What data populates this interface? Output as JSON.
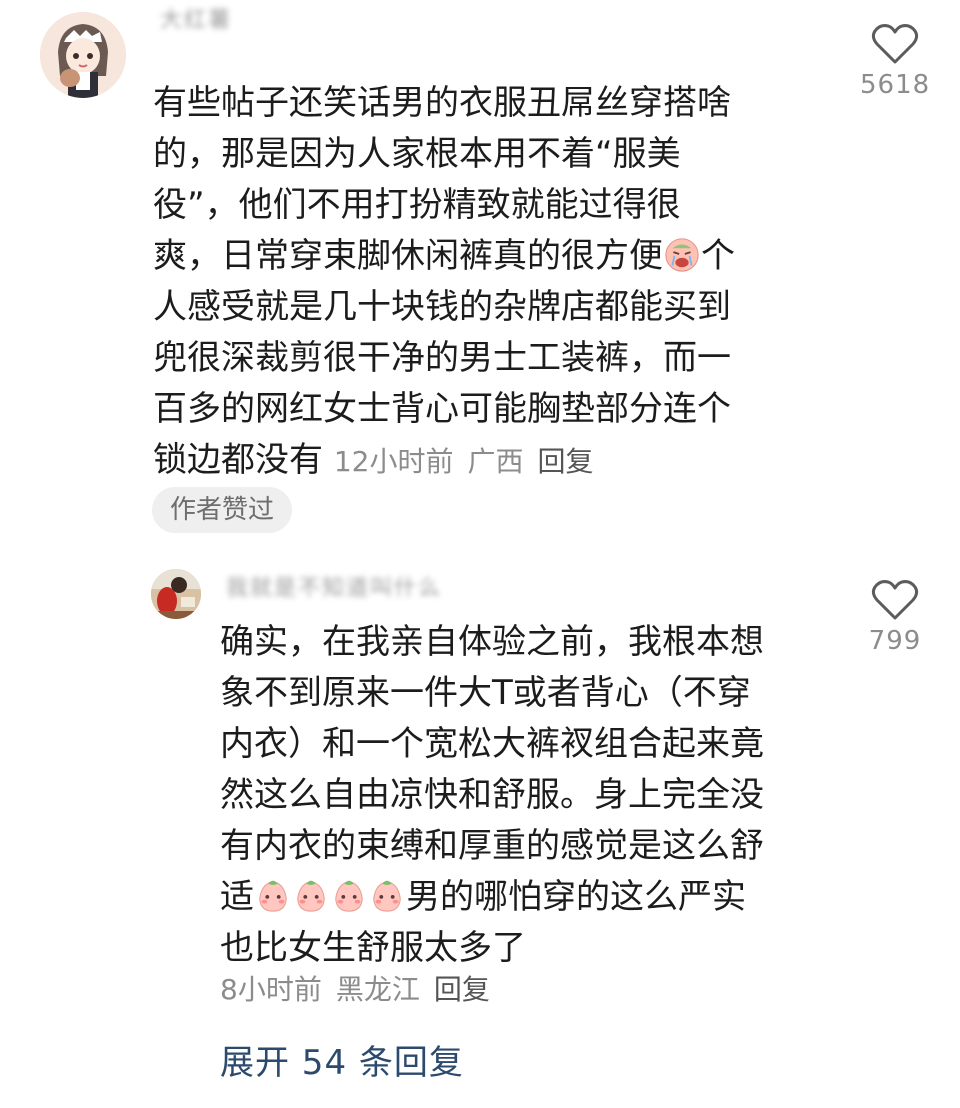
{
  "comments": [
    {
      "username_blurred": "大红薯",
      "avatar": "anime-girl-avatar",
      "text_lines": [
        "有些帖子还笑话男的衣服丑屌丝穿搭啥",
        "的，那是因为人家根本用不着“服美",
        "役”，他们不用打扮精致就能过得很",
        "爽，日常穿束脚休闲裤真的很方便",
        "个",
        "人感受就是几十块钱的杂牌店都能买到",
        "兜很深裁剪很干净的男士工装裤，而一",
        "百多的网红女士背心可能胸垫部分连个",
        "锁边都没有"
      ],
      "time": "12小时前",
      "location": "广西",
      "reply_label": "回复",
      "likes": "5618",
      "badge": "作者赞过"
    },
    {
      "username_blurred": "我就是不知道叫什么",
      "avatar": "photo-avatar",
      "text_lines": [
        "确实，在我亲自体验之前，我根本想",
        "象不到原来一件大T或者背心（不穿",
        "内衣）和一个宽松大裤衩组合起来竟",
        "然这么自由凉快和舒服。身上完全没",
        "有内衣的束缚和厚重的感觉是这么舒",
        "适",
        "男的哪怕穿的这么严实",
        "也比女生舒服太多了"
      ],
      "time": "8小时前",
      "location": "黑龙江",
      "reply_label": "回复",
      "likes": "799"
    }
  ],
  "expand_replies": "展开 54 条回复",
  "colors": {
    "text": "#1c1c1c",
    "meta": "#8c8c8c",
    "badge_bg": "#efefef",
    "expand": "#2c4a6e"
  }
}
